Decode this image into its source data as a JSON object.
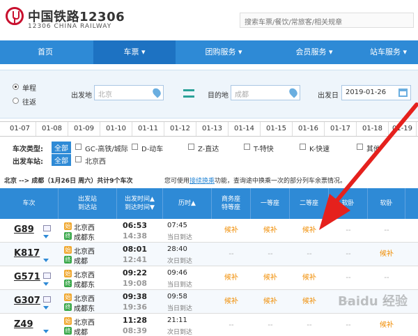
{
  "header": {
    "logo_cn": "中国铁路12306",
    "logo_en": "12306 CHINA RAILWAY",
    "search_placeholder": "搜索车票/餐饮/常旅客/相关规章"
  },
  "nav": [
    "首页",
    "车票 ▾",
    "团购服务 ▾",
    "会员服务 ▾",
    "站车服务 ▾"
  ],
  "query": {
    "trip_oneway": "单程",
    "trip_return": "往返",
    "from_label": "出发地",
    "from_value": "北京",
    "to_label": "目的地",
    "to_value": "成都",
    "date_label": "出发日",
    "date_value": "2019-01-26"
  },
  "dates": [
    "01-07",
    "01-08",
    "01-09",
    "01-10",
    "01-11",
    "01-12",
    "01-13",
    "01-14",
    "01-15",
    "01-16",
    "01-17",
    "01-18",
    "01-19"
  ],
  "filters": {
    "type_label": "车次类型:",
    "all": "全部",
    "types": [
      "GC-高铁/城际",
      "D-动车",
      "Z-直达",
      "T-特快",
      "K-快速",
      "其他"
    ],
    "station_label": "出发车站:",
    "stations": [
      "北京西"
    ]
  },
  "summary": {
    "route": "北京 --> 成都（1月26日 周六）共计9个车次",
    "tip_pre": "您可使用",
    "tip_link": "接续换乘",
    "tip_post": "功能，查询途中换乘一次的部分列车余票情况。"
  },
  "table": {
    "headers": [
      "车次",
      "出发站\n到达站",
      "出发时间▲\n到达时间▼",
      "历时▲",
      "商务座\n特等座",
      "一等座",
      "二等座",
      "软卧",
      "软卧"
    ],
    "rows": [
      {
        "train": "G89",
        "from": "北京西",
        "to": "成都东",
        "dep": "06:53",
        "arr": "14:38",
        "dur": "07:45",
        "day": "当日到达",
        "seats": [
          "候补",
          "候补",
          "候补",
          "--",
          "--",
          "--"
        ]
      },
      {
        "train": "K817",
        "from": "北京西",
        "to": "成都",
        "dep": "08:01",
        "arr": "12:41",
        "dur": "28:40",
        "day": "次日到达",
        "seats": [
          "--",
          "--",
          "--",
          "--",
          "--",
          "候补"
        ]
      },
      {
        "train": "G571",
        "from": "北京西",
        "to": "成都东",
        "dep": "09:22",
        "arr": "19:08",
        "dur": "09:46",
        "day": "当日到达",
        "seats": [
          "候补",
          "候补",
          "候补",
          "--",
          "--",
          "--"
        ]
      },
      {
        "train": "G307",
        "from": "北京西",
        "to": "成都东",
        "dep": "09:38",
        "arr": "19:36",
        "dur": "09:58",
        "day": "当日到达",
        "seats": [
          "候补",
          "候补",
          "候补",
          "--",
          "--",
          "--"
        ]
      },
      {
        "train": "Z49",
        "from": "北京西",
        "to": "成都",
        "dep": "11:28",
        "arr": "08:39",
        "dur": "21:11",
        "day": "次日到达",
        "seats": [
          "--",
          "--",
          "--",
          "--",
          "--",
          "候补"
        ]
      }
    ]
  },
  "watermark": "Baidu 经验",
  "colors": {
    "nav_blue": "#2e8ad6",
    "alert_arrow": "#e5211d",
    "seat_orange": "#f08c00"
  }
}
